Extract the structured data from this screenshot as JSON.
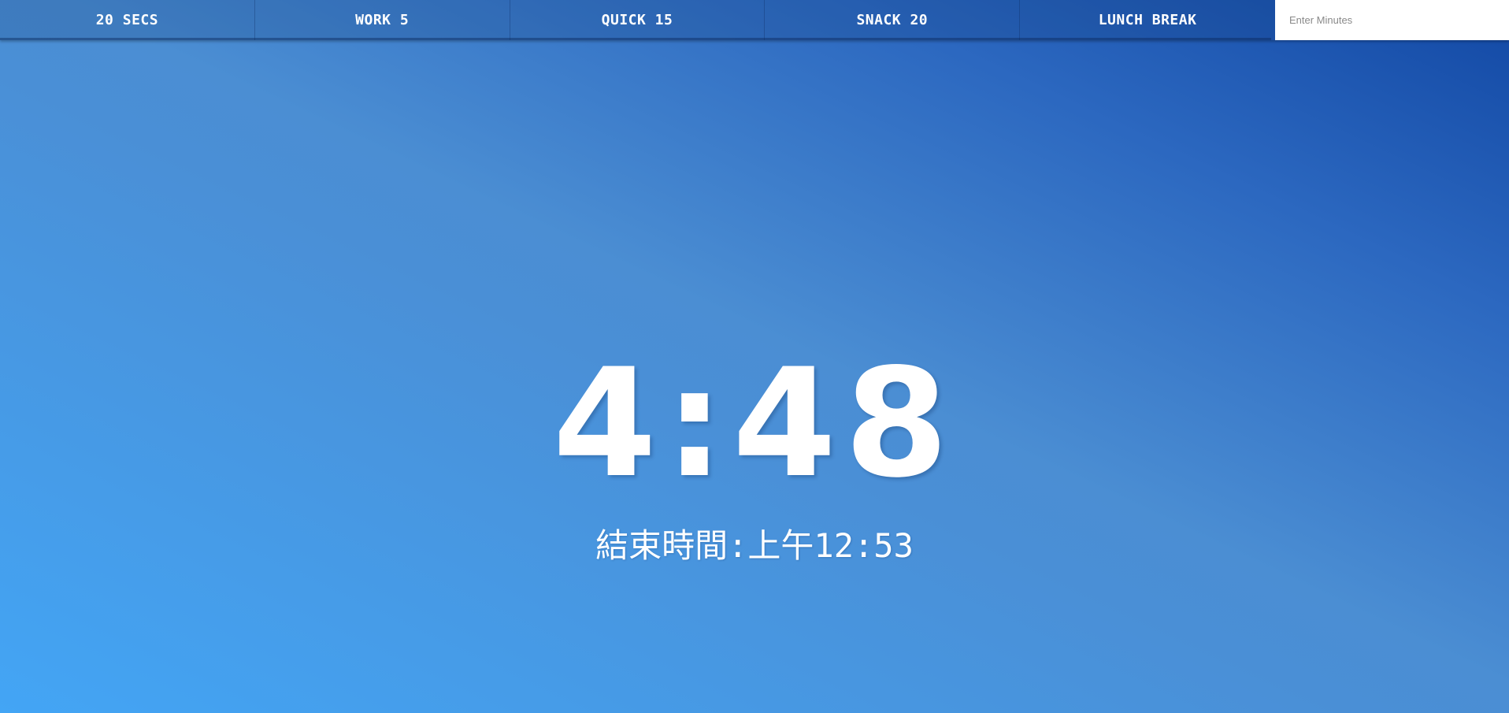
{
  "presets": [
    {
      "label": "20 SECS"
    },
    {
      "label": "WORK 5"
    },
    {
      "label": "QUICK 15"
    },
    {
      "label": "SNACK 20"
    },
    {
      "label": "LUNCH BREAK"
    }
  ],
  "custom_input": {
    "placeholder": "Enter Minutes",
    "value": ""
  },
  "timer": {
    "time_left": "4:48",
    "end_time_text": "結束時間:上午12:53"
  },
  "colors": {
    "text": "#ffffff",
    "gradient_light": "#43a5f5",
    "gradient_dark": "#1248a4",
    "input_background": "#ffffff"
  }
}
